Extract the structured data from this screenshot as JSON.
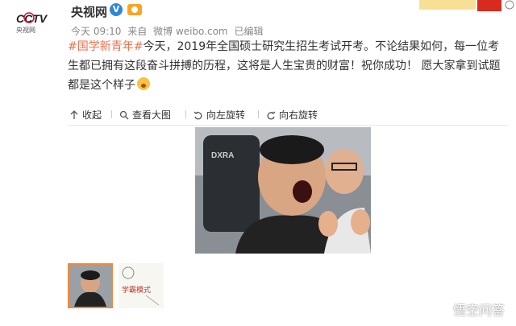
{
  "author": {
    "logo_text": "CCTV",
    "logo_subtext": "央视网",
    "name": "央视网"
  },
  "meta": {
    "time": "今天 09:10",
    "from_label": "来自",
    "source": "微博 weibo.com",
    "edited": "已编辑"
  },
  "post": {
    "hashtag": "#国学新青年#",
    "text": "今天，2019年全国硕士研究生招生考试开考。不论结果如何，每一位考生都已拥有这段奋斗拼搏的历程，这将是人生宝贵的财富！祝你成功！ 愿大家拿到试题都是这个样子"
  },
  "toolbar": {
    "collapse": "收起",
    "view_large": "查看大图",
    "rotate_left": "向左旋转",
    "rotate_right": "向右旋转"
  },
  "thumbnail2_text": "学霸模式",
  "watermark": "悟空问答",
  "colors": {
    "hashtag": "#eb7350",
    "verify": "#2f86d6",
    "thumb_border": "#f08a3b"
  }
}
